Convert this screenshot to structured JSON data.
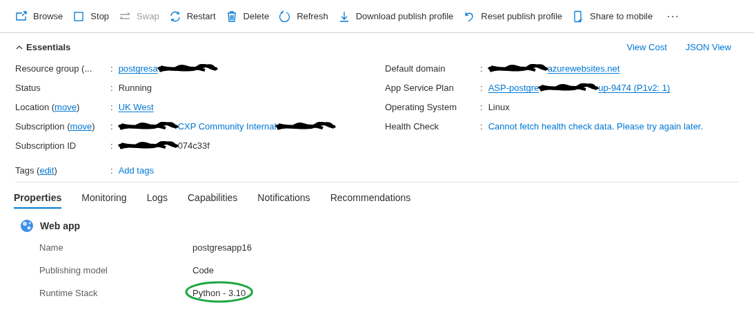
{
  "toolbar": [
    {
      "label": "Browse",
      "disabled": false
    },
    {
      "label": "Stop",
      "disabled": false
    },
    {
      "label": "Swap",
      "disabled": true
    },
    {
      "label": "Restart",
      "disabled": false
    },
    {
      "label": "Delete",
      "disabled": false
    },
    {
      "label": "Refresh",
      "disabled": false
    },
    {
      "label": "Download publish profile",
      "disabled": false
    },
    {
      "label": "Reset publish profile",
      "disabled": false
    },
    {
      "label": "Share to mobile",
      "disabled": false
    }
  ],
  "more": "···",
  "essentials": {
    "title": "Essentials",
    "expanded": true,
    "links": [
      "View Cost",
      "JSON View"
    ],
    "left": [
      {
        "label": "Resource group (...",
        "colon": ":",
        "parts": [
          {
            "kind": "link",
            "text": "postgresa"
          },
          {
            "kind": "redaction"
          }
        ]
      },
      {
        "label": "Status",
        "colon": ":",
        "parts": [
          {
            "kind": "text",
            "text": "Running"
          }
        ]
      },
      {
        "label": "Location (",
        "label_link": "move",
        "label_end": ")",
        "colon": ":",
        "parts": [
          {
            "kind": "link",
            "text": "UK West"
          }
        ]
      },
      {
        "label": "Subscription (",
        "label_link": "move",
        "label_end": ")",
        "colon": ":",
        "parts": [
          {
            "kind": "redaction"
          },
          {
            "kind": "link",
            "text": "CXP Community Internal"
          },
          {
            "kind": "redaction"
          }
        ]
      },
      {
        "label": "Subscription ID",
        "colon": ":",
        "parts": [
          {
            "kind": "redaction"
          },
          {
            "kind": "text",
            "text": "074c33f"
          }
        ]
      }
    ],
    "right": [
      {
        "label": "Default domain",
        "colon": ":",
        "parts": [
          {
            "kind": "redaction"
          },
          {
            "kind": "link",
            "text": "azurewebsites.net"
          }
        ]
      },
      {
        "label": "App Service Plan",
        "colon": ":",
        "parts": [
          {
            "kind": "link",
            "text": "ASP-postgre"
          },
          {
            "kind": "redaction"
          },
          {
            "kind": "link",
            "text": "up-9474 (P1v2: 1)"
          }
        ]
      },
      {
        "label": "Operating System",
        "colon": ":",
        "parts": [
          {
            "kind": "text",
            "text": "Linux"
          }
        ]
      },
      {
        "label": "Health Check",
        "colon": ":",
        "parts": [
          {
            "kind": "link",
            "text": "Cannot fetch health check data. Please try again later."
          }
        ]
      }
    ],
    "tags": {
      "label": "Tags (",
      "label_link": "edit",
      "label_end": ")",
      "colon": ":",
      "value": "Add tags"
    }
  },
  "tabs": [
    {
      "label": "Properties",
      "selected": true
    },
    {
      "label": "Monitoring",
      "selected": false
    },
    {
      "label": "Logs",
      "selected": false
    },
    {
      "label": "Capabilities",
      "selected": false
    },
    {
      "label": "Notifications",
      "selected": false
    },
    {
      "label": "Recommendations",
      "selected": false
    }
  ],
  "section": {
    "title": "Web app",
    "rows": [
      {
        "label": "Name",
        "value": "postgresapp16",
        "highlighted": false
      },
      {
        "label": "Publishing model",
        "value": "Code",
        "highlighted": false
      },
      {
        "label": "Runtime Stack",
        "value": "Python - 3.10",
        "highlighted": true
      }
    ]
  }
}
